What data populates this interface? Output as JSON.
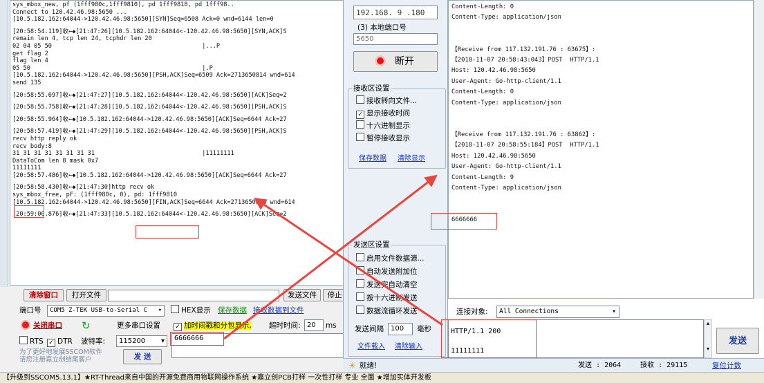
{
  "sscom": {
    "log_lines": [
      "sys_mbox_new, pf (1fff980c,1fff9810), pd 1fff9818, pd 1fff98..",
      "Connect to 120.42.46.98:5650 ...",
      "[10.5.182.162:64044->120.42.46.98:5650][SYN]Seq=6508 Ack=0 wnd=6144 len=0",
      "",
      "[20:58:54.119]收←◆[21:47:26][10.5.182.162:64044<-120.42.46.98:5650][SYN,ACK]S",
      "remain len 4, tcp len 24, tcphdr len 20",
      "02 04 05 50                                          |...P",
      "get flag 2",
      "flag len 4",
      "05 50                                                |.P",
      "[10.5.182.162:64044->120.42.46.98:5650][PSH,ACK]Seq=6509 Ack=2713650814 wnd=614",
      "send 135",
      "",
      "[20:58:55.697]收←◆[21:47:27][10.5.182.162:64044<-120.42.46.98:5650][ACK]Seq=2",
      "",
      "[20:58:55.758]收←◆[21:47:28][10.5.182.162:64044<-120.42.46.98:5650][PSH,ACK]S",
      "",
      "[20:58:55.964]收←◆[10.5.182.162:64044->120.42.46.98:5650][ACK]Seq=6644 Ack=27",
      "",
      "[20:58:57.419]收←◆[21:47:29][10.5.182.162:64044<-120.42.46.98:5650][PSH,ACK]S",
      "recv http reply ok",
      "recv body:8",
      "31 31 31 31 31 31 31 31                              |11111111",
      "DataToCom len 8 mask 0x7",
      "11111111",
      "[20:58:57.486]收←◆[10.5.182.162:64044->120.42.46.98:5650][ACK]Seq=6644 Ack=27",
      "",
      "[20:58:58.430]收←◆[21:47:30]http recv ok",
      "sys_mbox_free, pF: (1fff980c, 0), pd: 1fff9810",
      "[10.5.182.162:64044->120.42.46.98:5650][FIN,ACK]Seq=6644 Ack=2713650838 wnd=614",
      "",
      "[20:59:00.876]收←◆[21:47:33][10.5.182.162:64044<-120.42.46.98:5650][ACK]Seq=2"
    ],
    "clear_window": "清除窗口",
    "open_file": "打开文件",
    "send_file": "发送文件",
    "stop": "停止",
    "port_label": "端口号",
    "port_value": "COM5 Z-TEK USB-to-Serial C",
    "hex_display": "HEX显示",
    "save_data": "保存数据",
    "recv_to_file": "接收数据到文件",
    "close_port": "关闭串口",
    "more_settings": "更多串口设置",
    "add_timestamp": "加时间戳和分包显示,",
    "timeout_label": "超时时间:",
    "timeout_value": "20",
    "timeout_unit": "ms",
    "rts": "RTS",
    "dtr": "DTR",
    "baud_label": "波特率:",
    "baud_value": "115200",
    "send_input": "6666666",
    "promo": "为了更好地发展SSCOM软件\n请您注册嘉立创结尾客户",
    "send": "发 送"
  },
  "panel": {
    "local_ip": "192.168. 9 .180",
    "local_port_label": "(3) 本地端口号",
    "local_port": "5650",
    "disconnect": "断开",
    "recv_settings": "接收区设置",
    "recv_opts": [
      "接收转向文件...",
      "显示接收时间",
      "十六进制显示",
      "暂停接收显示"
    ],
    "save_data": "保存数据",
    "clear_display": "清除显示",
    "send_settings": "发送区设置",
    "send_opts": [
      "启用文件数据源...",
      "自动发送附加位",
      "发送完自动清空",
      "按十六进制发送",
      "数据流循环发送"
    ],
    "interval_label": "发送间隔",
    "interval_value": "100",
    "interval_unit": "毫秒",
    "file_load": "文件载入",
    "clear_input": "清除输入",
    "ready": "就绪!"
  },
  "recv": {
    "text": "Content-Length: 0\nContent-Type: application/json\n\n\n【Receive from 117.132.191.76 : 63675】:\n【2018-11-07 20:58:43:043】POST  HTTP/1.1\nHost: 120.42.46.98:5650\nUser-Agent: Go-http-client/1.1\nContent-Length: 0\nContent-Type: application/json\n\n\n【Receive from 117.132.191.76 : 63862】:\n【2018-11-07 20:58:55:184】POST  HTTP/1.1\nHost: 120.42.46.98:5650\nUser-Agent: Go-http-client/1.1\nContent-Length: 9\nContent-Type: application/json\n\n\n6666666",
    "conn_label": "连接对象:",
    "conn_value": "All Connections",
    "send_text_1": "HTTP/1.1 200",
    "send_text_2": "11111111",
    "send_button": "发送",
    "sent_label": "发送 : 2064",
    "recv_label": "接收 : 29115",
    "reset_count": "复位计数"
  },
  "banner": "【升级到SSCOM5.13.1】★RT-Thread来自中国的开源免费商用物联网操作系统 ★嘉立创PCB打样 一次性打样 专业 全面 ★增加实体开发板",
  "colors": {
    "accent_red": "#e8463f",
    "link_blue": "#1233cc"
  }
}
